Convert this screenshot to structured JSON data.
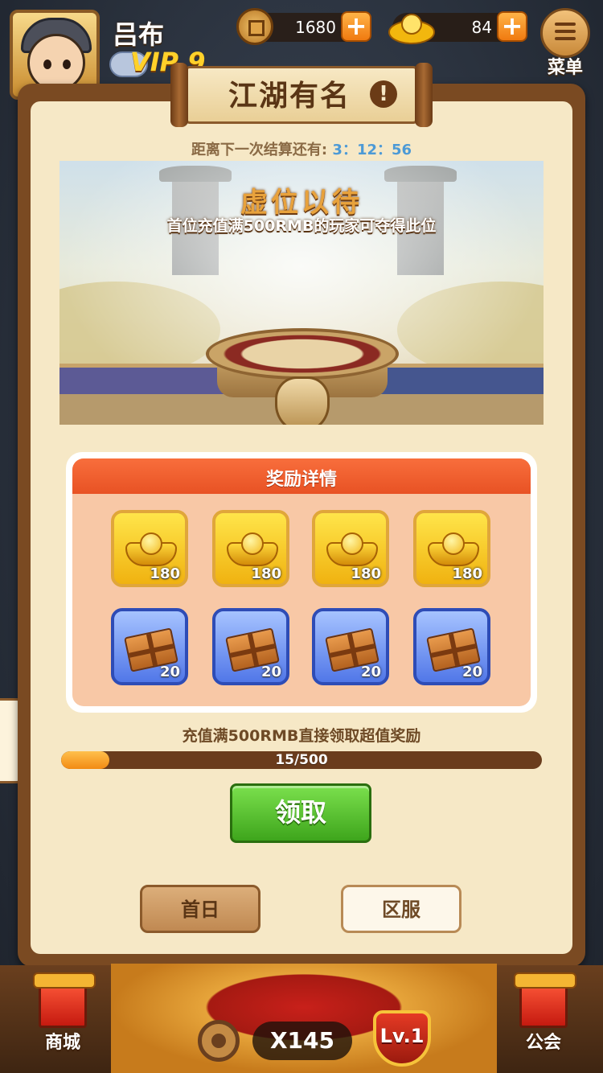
{
  "player": {
    "name": "吕布",
    "vip_label": "VIP 9"
  },
  "resources": {
    "coins": "1680",
    "gold": "84",
    "plus": "+"
  },
  "menu": {
    "label": "菜单"
  },
  "panel": {
    "title": "江湖有名",
    "info_glyph": "!",
    "countdown_label": "距离下一次结算还有:",
    "countdown_time": "3：12：56",
    "scene_title": "虚位以待",
    "scene_subtitle": "首位充值满500RMB的玩家可夺得此位"
  },
  "rewards": {
    "header": "奖励详情",
    "items": [
      {
        "icon": "gold-ingot-icon",
        "qty": "180"
      },
      {
        "icon": "gold-ingot-icon",
        "qty": "180"
      },
      {
        "icon": "gold-ingot-icon",
        "qty": "180"
      },
      {
        "icon": "gold-ingot-icon",
        "qty": "180"
      },
      {
        "icon": "treasure-chest-icon",
        "qty": "20"
      },
      {
        "icon": "treasure-chest-icon",
        "qty": "20"
      },
      {
        "icon": "treasure-chest-icon",
        "qty": "20"
      },
      {
        "icon": "treasure-chest-icon",
        "qty": "20"
      }
    ]
  },
  "progress": {
    "label": "充值满500RMB直接领取超值奖励",
    "text": "15/500",
    "current": 15,
    "max": 500
  },
  "buttons": {
    "claim": "领取",
    "tab_first_day": "首日",
    "tab_server": "区服"
  },
  "bottom": {
    "shop": "商城",
    "guild": "公会",
    "multiplier": "X145",
    "level": "Lv.1"
  },
  "colors": {
    "panel_border": "#7a4a22",
    "panel_bg": "#f6e8c6",
    "accent_orange": "#e85224",
    "claim_green": "#3ea51c",
    "countdown_blue": "#4d9ad6"
  }
}
